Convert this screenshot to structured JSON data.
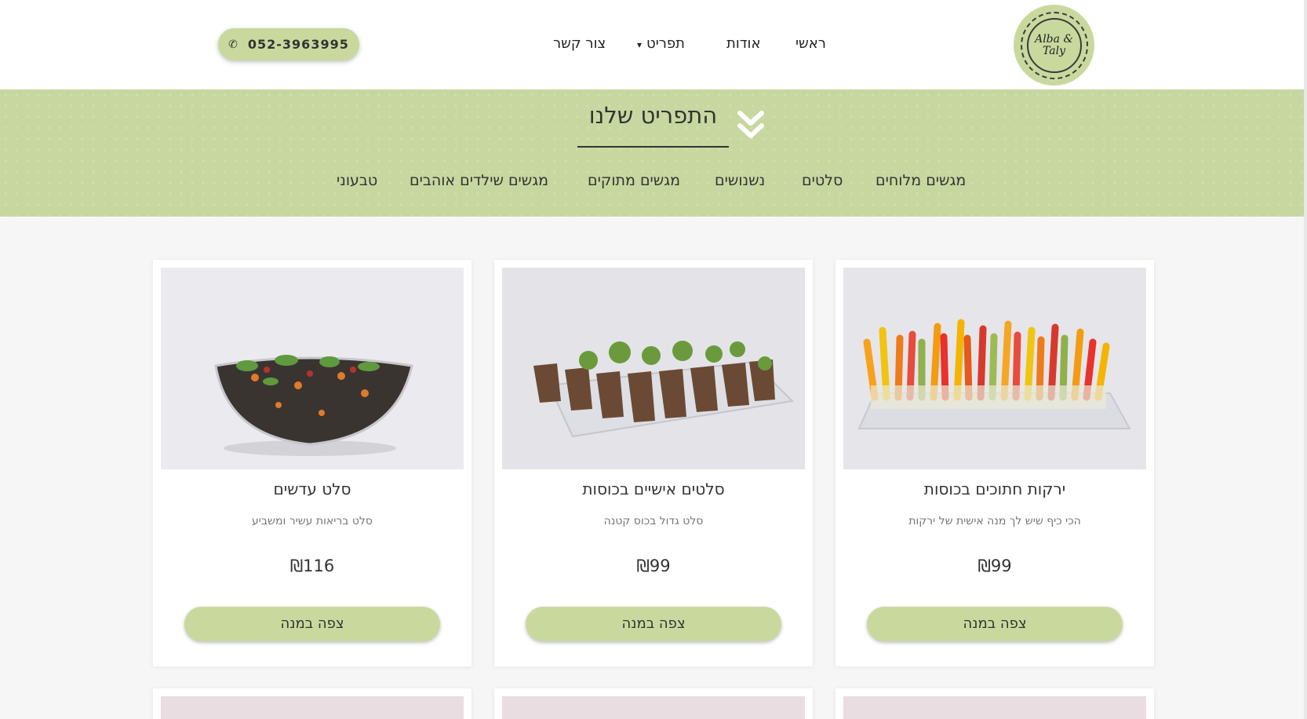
{
  "header": {
    "logo_text": "Alba & Taly",
    "nav": [
      {
        "label": "ראשי"
      },
      {
        "label": "אודות"
      },
      {
        "label": "תפריט",
        "has_dropdown": true
      },
      {
        "label": "צור קשר"
      }
    ],
    "phone": "052-3963995"
  },
  "banner": {
    "title": "התפריט שלנו",
    "categories": [
      "מגשים מלוחים",
      "סלטים",
      "נשנושים",
      "מגשים מתוקים",
      "מגשים שילדים אוהבים",
      "טבעוני"
    ]
  },
  "products": [
    {
      "title": "ירקות חתוכים בכוסות",
      "description": "הכי כיף שיש לך מנה אישית של ירקות",
      "price": "₪99",
      "button": "צפה במנה",
      "image": "vegetable-sticks-image"
    },
    {
      "title": "סלטים אישיים בכוסות",
      "description": "סלט גדול בכוס קטנה",
      "price": "₪99",
      "button": "צפה במנה",
      "image": "salad-cups-image"
    },
    {
      "title": "סלט עדשים",
      "description": "סלט בריאות עשיר ומשביע",
      "price": "₪116",
      "button": "צפה במנה",
      "image": "lentil-salad-image"
    }
  ],
  "colors": {
    "accent_green": "#c9d99e",
    "banner_green": "#c7d79f",
    "text_dark": "#333333"
  }
}
